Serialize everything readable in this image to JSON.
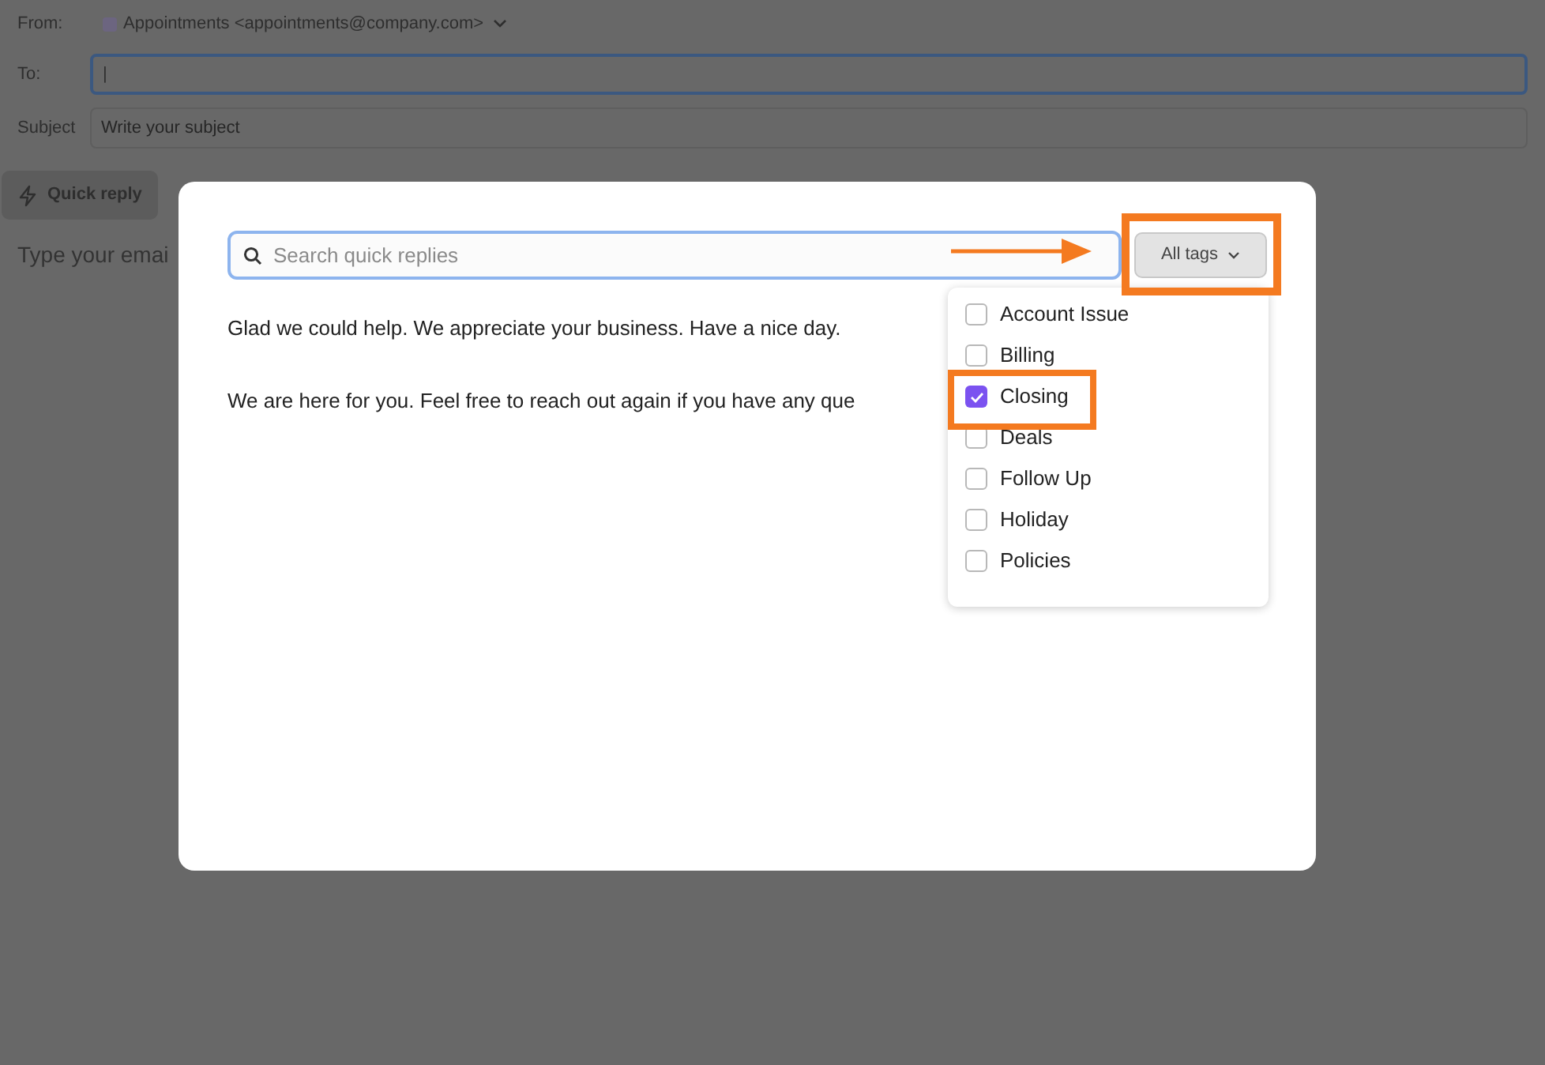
{
  "composer": {
    "from_label": "From:",
    "from_value": "Appointments <appointments@company.com>",
    "to_label": "To:",
    "to_value": "|",
    "subject_label": "Subject",
    "subject_placeholder": "Write your subject",
    "quick_reply_button": "Quick reply",
    "body_placeholder": "Type your emai"
  },
  "modal": {
    "search": {
      "placeholder": "Search quick replies"
    },
    "tags_button": "All tags",
    "replies": [
      "Glad we could help. We appreciate your business. Have a nice day.",
      "We are here for you. Feel free to reach out again if you have any que"
    ],
    "tags": [
      {
        "label": "Account Issue",
        "checked": false
      },
      {
        "label": "Billing",
        "checked": false
      },
      {
        "label": "Closing",
        "checked": true
      },
      {
        "label": "Deals",
        "checked": false
      },
      {
        "label": "Follow Up",
        "checked": false
      },
      {
        "label": "Holiday",
        "checked": false
      },
      {
        "label": "Policies",
        "checked": false
      }
    ]
  }
}
